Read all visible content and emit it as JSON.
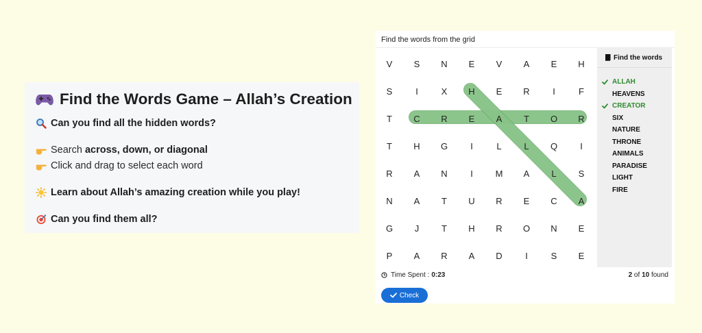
{
  "info": {
    "title": "Find the Words Game – Allah’s Creation",
    "question": "Can you find all the hidden words?",
    "search_prefix": "Search ",
    "search_bold": "across, down, or diagonal",
    "drag_text": "Click and drag to select each word",
    "learn_text": "Learn about Allah’s amazing creation while you play!",
    "find_all": "Can you find them all?"
  },
  "game": {
    "header": "Find the words from the grid",
    "grid": [
      [
        "V",
        "S",
        "N",
        "E",
        "V",
        "A",
        "E",
        "H"
      ],
      [
        "S",
        "I",
        "X",
        "H",
        "E",
        "R",
        "I",
        "F"
      ],
      [
        "T",
        "C",
        "R",
        "E",
        "A",
        "T",
        "O",
        "R"
      ],
      [
        "T",
        "H",
        "G",
        "I",
        "L",
        "L",
        "Q",
        "I"
      ],
      [
        "R",
        "A",
        "N",
        "I",
        "M",
        "A",
        "L",
        "S"
      ],
      [
        "N",
        "A",
        "T",
        "U",
        "R",
        "E",
        "C",
        "A"
      ],
      [
        "G",
        "J",
        "T",
        "H",
        "R",
        "O",
        "N",
        "E"
      ],
      [
        "P",
        "A",
        "R",
        "A",
        "D",
        "I",
        "S",
        "E"
      ]
    ],
    "highlights": [
      {
        "word": "CREATOR",
        "from": [
          2,
          1
        ],
        "to": [
          2,
          7
        ]
      },
      {
        "word": "ALLAH",
        "from": [
          5,
          7
        ],
        "to": [
          1,
          3
        ]
      }
    ],
    "highlight_color": "#8fc98f",
    "words_heading": "Find the words",
    "words": [
      {
        "text": "ALLAH",
        "found": true
      },
      {
        "text": "HEAVENS",
        "found": false
      },
      {
        "text": "CREATOR",
        "found": true
      },
      {
        "text": "SIX",
        "found": false
      },
      {
        "text": "NATURE",
        "found": false
      },
      {
        "text": "THRONE",
        "found": false
      },
      {
        "text": "ANIMALS",
        "found": false
      },
      {
        "text": "PARADISE",
        "found": false
      },
      {
        "text": "LIGHT",
        "found": false
      },
      {
        "text": "FIRE",
        "found": false
      }
    ],
    "time_label": "Time Spent :",
    "time_value": "0:23",
    "found_count": "2",
    "found_of": " of ",
    "total_count": "10",
    "found_suffix": " found",
    "check_label": "Check",
    "accent": "#1a6fd6",
    "found_color": "#2e8b2e"
  }
}
